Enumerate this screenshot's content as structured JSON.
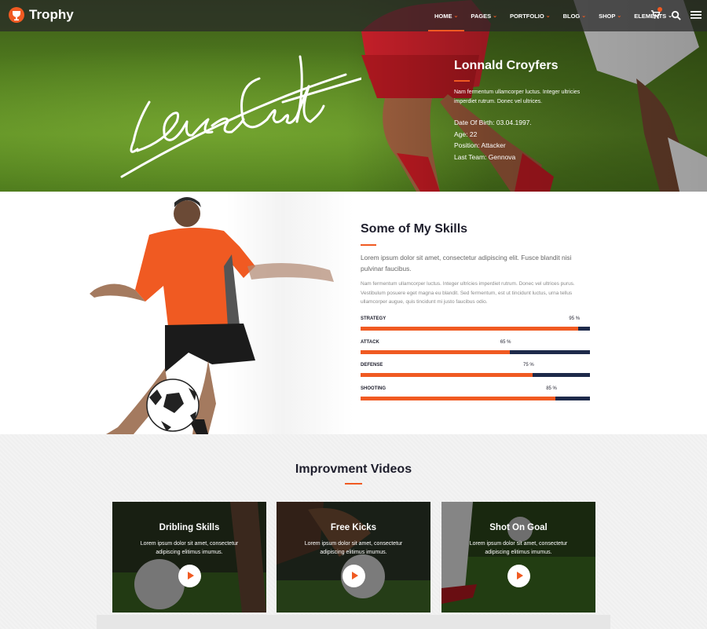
{
  "brand": {
    "name": "Trophy",
    "accent": "#f05a22",
    "dark": "#1e2a4a"
  },
  "nav": {
    "items": [
      {
        "label": "HOME",
        "active": true
      },
      {
        "label": "PAGES"
      },
      {
        "label": "PORTFOLIO"
      },
      {
        "label": "BLOG"
      },
      {
        "label": "SHOP"
      },
      {
        "label": "ELEMENTS"
      }
    ],
    "icons": [
      "cart-icon",
      "search-icon",
      "menu-icon"
    ]
  },
  "hero": {
    "signature_text": "LaraCroft",
    "name": "Lonnald Croyfers",
    "description": "Nam fermentum ullamcorper luctus. Integer ultricies imperdiet rutrum. Donec vel ultrices.",
    "facts": [
      "Date Of Birth: 03.04.1997.",
      "Age: 22",
      "Position: Attacker",
      "Last Team: Gennova"
    ]
  },
  "skills": {
    "title": "Some of My Skills",
    "lead": "Lorem ipsum dolor sit amet, consectetur adipiscing elit. Fusce blandit nisi pulvinar faucibus.",
    "body": "Nam fermentum ullamcorper luctus. Integer ultricies imperdiet rutrum. Donec vel ultrices purus. Vestibulum posuere eget magna eu blandit. Sed fermentum, est ut tincidunt luctus, urna tellus ullamcorper augue, quis tincidunt mi justo faucibus odio.",
    "items": [
      {
        "name": "STRATEGY",
        "percent": 95,
        "label": "95 %"
      },
      {
        "name": "ATTACK",
        "percent": 65,
        "label": "65 %"
      },
      {
        "name": "DEFENSE",
        "percent": 75,
        "label": "75 %"
      },
      {
        "name": "SHOOTING",
        "percent": 85,
        "label": "85 %"
      }
    ]
  },
  "videos": {
    "title": "Improvment Videos",
    "cards": [
      {
        "title": "Dribling Skills",
        "desc": "Lorem ipsum dolor sit amet, consectetur adipiscing elitimus imumus."
      },
      {
        "title": "Free Kicks",
        "desc": "Lorem ipsum dolor sit amet, consectetur adipiscing elitimus imumus."
      },
      {
        "title": "Shot On Goal",
        "desc": "Lorem ipsum dolor sit amet, consectetur adipiscing elitimus imumus."
      }
    ]
  }
}
